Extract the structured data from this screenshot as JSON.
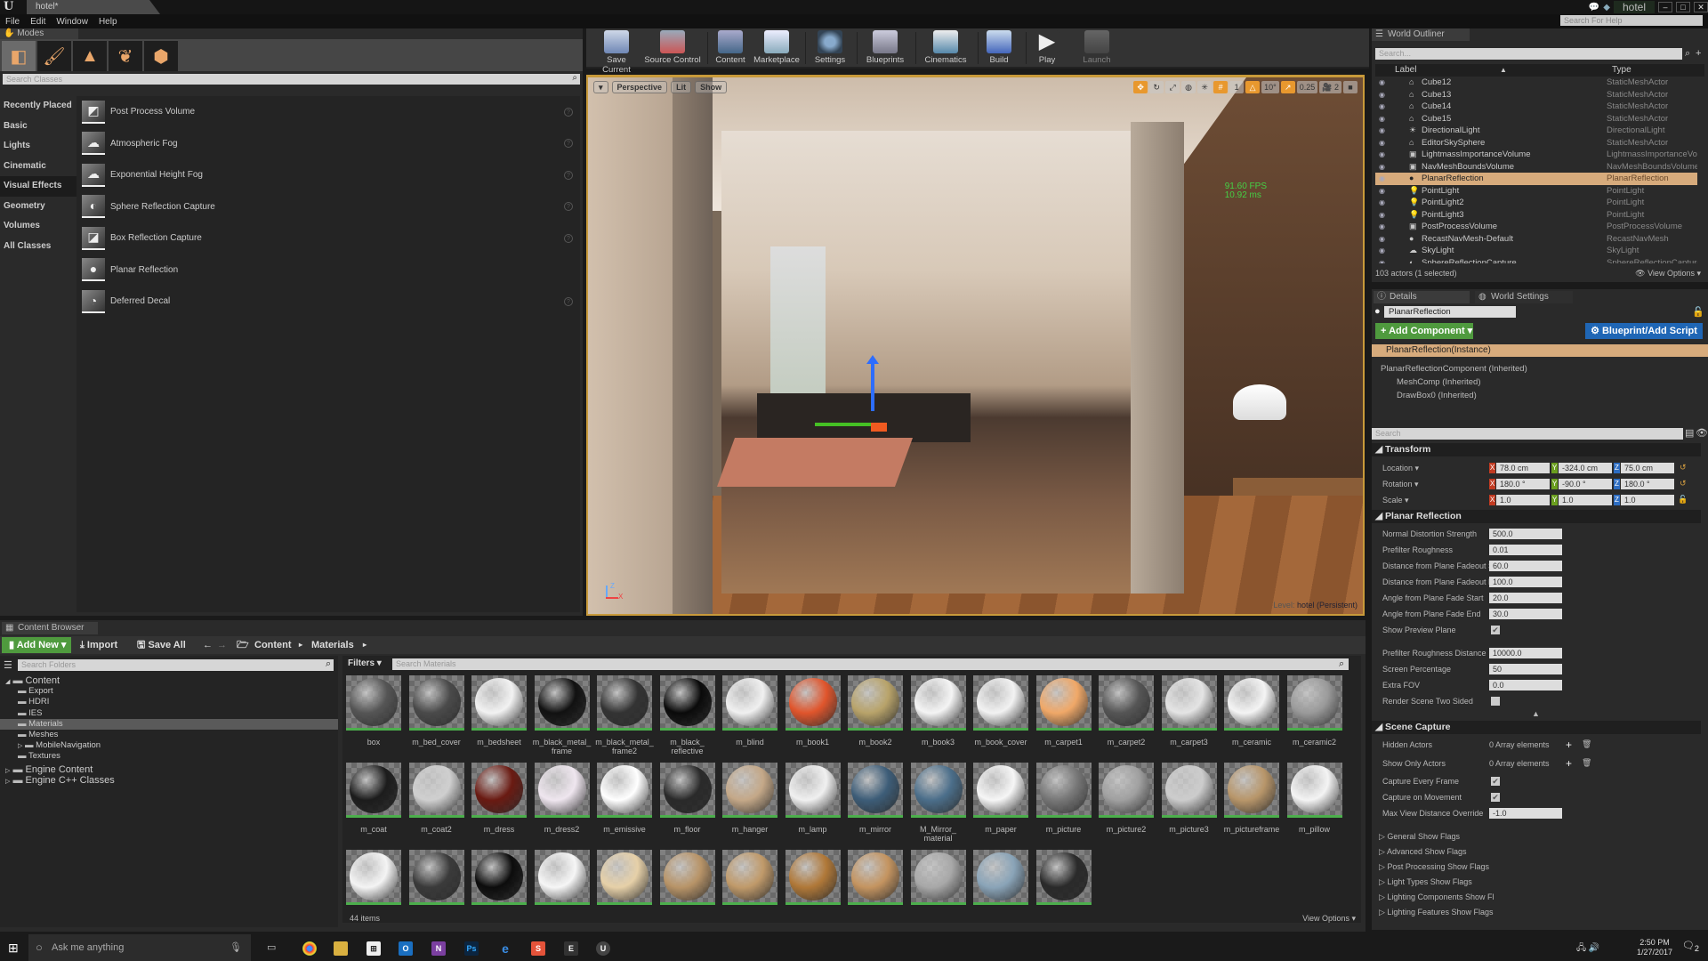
{
  "window": {
    "app_logo": "U",
    "tab_title": "hotel*",
    "project_name": "hotel",
    "minimize": "–",
    "maximize": "□",
    "close": "✕",
    "help_search_placeholder": "Search For Help"
  },
  "menu": [
    "File",
    "Edit",
    "Window",
    "Help"
  ],
  "modes": {
    "tab_label": "Modes",
    "mode_icons": [
      "place-mode-icon",
      "paint-mode-icon",
      "landscape-mode-icon",
      "foliage-mode-icon",
      "geometry-mode-icon"
    ],
    "search_placeholder": "Search Classes",
    "categories": [
      "Recently Placed",
      "Basic",
      "Lights",
      "Cinematic",
      "Visual Effects",
      "Geometry",
      "Volumes",
      "All Classes"
    ],
    "selected_category": "Visual Effects",
    "items": [
      "Post Process Volume",
      "Atmospheric Fog",
      "Exponential Height Fog",
      "Sphere Reflection Capture",
      "Box Reflection Capture",
      "Planar Reflection",
      "Deferred Decal"
    ]
  },
  "toolbar": [
    "Save Current",
    "Source Control",
    "Content",
    "Marketplace",
    "Settings",
    "Blueprints",
    "Cinematics",
    "Build",
    "Play",
    "Launch"
  ],
  "viewport": {
    "view_mode": "Perspective",
    "lighting": "Lit",
    "show": "Show",
    "grid_snap": "1",
    "rotation_snap": "10°",
    "scale_snap": "0.25",
    "camera_speed": "2",
    "fps": "91.60 FPS",
    "frame_ms": "10.92 ms",
    "level_label": "Level:",
    "level_name": "hotel (Persistent)",
    "axis_z": "Z",
    "axis_x": "X"
  },
  "outliner": {
    "tab_label": "World Outliner",
    "search_placeholder": "Search...",
    "col_label": "Label",
    "col_type": "Type",
    "rows": [
      {
        "label": "Cube12",
        "type": "StaticMeshActor",
        "icon": "mesh"
      },
      {
        "label": "Cube13",
        "type": "StaticMeshActor",
        "icon": "mesh"
      },
      {
        "label": "Cube14",
        "type": "StaticMeshActor",
        "icon": "mesh"
      },
      {
        "label": "Cube15",
        "type": "StaticMeshActor",
        "icon": "mesh"
      },
      {
        "label": "DirectionalLight",
        "type": "DirectionalLight",
        "icon": "sun"
      },
      {
        "label": "EditorSkySphere",
        "type": "StaticMeshActor",
        "icon": "mesh"
      },
      {
        "label": "LightmassImportanceVolume",
        "type": "LightmassImportanceVo",
        "icon": "volume"
      },
      {
        "label": "NavMeshBoundsVolume",
        "type": "NavMeshBoundsVolume",
        "icon": "volume"
      },
      {
        "label": "PlanarReflection",
        "type": "PlanarReflection",
        "icon": "sphere",
        "selected": true
      },
      {
        "label": "PointLight",
        "type": "PointLight",
        "icon": "bulb"
      },
      {
        "label": "PointLight2",
        "type": "PointLight",
        "icon": "bulb"
      },
      {
        "label": "PointLight3",
        "type": "PointLight",
        "icon": "bulb"
      },
      {
        "label": "PostProcessVolume",
        "type": "PostProcessVolume",
        "icon": "volume"
      },
      {
        "label": "RecastNavMesh-Default",
        "type": "RecastNavMesh",
        "icon": "sphere"
      },
      {
        "label": "SkyLight",
        "type": "SkyLight",
        "icon": "sky"
      },
      {
        "label": "SphereReflectionCapture",
        "type": "SphereReflectionCapture",
        "icon": "capture"
      }
    ],
    "status": "103 actors (1 selected)",
    "view_options": "View Options"
  },
  "details": {
    "tab_details": "Details",
    "tab_world_settings": "World Settings",
    "actor_name": "PlanarReflection",
    "add_component": "+ Add Component ▾",
    "blueprint_script": "Blueprint/Add Script",
    "instance": "PlanarReflection(Instance)",
    "components": [
      "PlanarReflectionComponent (Inherited)",
      "MeshComp (Inherited)",
      "DrawBox0 (Inherited)"
    ],
    "search_placeholder": "Search",
    "transform": {
      "title": "Transform",
      "location_label": "Location ▾",
      "location": [
        "78.0 cm",
        "-324.0 cm",
        "75.0 cm"
      ],
      "rotation_label": "Rotation ▾",
      "rotation": [
        "180.0 °",
        "-90.0 °",
        "180.0 °"
      ],
      "scale_label": "Scale ▾",
      "scale": [
        "1.0",
        "1.0",
        "1.0"
      ]
    },
    "planar_reflection": {
      "title": "Planar Reflection",
      "props": [
        {
          "label": "Normal Distortion Strength",
          "value": "500.0"
        },
        {
          "label": "Prefilter Roughness",
          "value": "0.01"
        },
        {
          "label": "Distance from Plane Fadeout S",
          "value": "60.0"
        },
        {
          "label": "Distance from Plane Fadeout E",
          "value": "100.0"
        },
        {
          "label": "Angle from Plane Fade Start",
          "value": "20.0"
        },
        {
          "label": "Angle from Plane Fade End",
          "value": "30.0"
        }
      ],
      "show_preview_plane": {
        "label": "Show Preview Plane",
        "checked": true
      },
      "advanced": [
        {
          "label": "Prefilter Roughness Distance",
          "value": "10000.0"
        },
        {
          "label": "Screen Percentage",
          "value": "50"
        },
        {
          "label": "Extra FOV",
          "value": "0.0"
        }
      ],
      "render_two_sided": {
        "label": "Render Scene Two Sided",
        "checked": false
      }
    },
    "scene_capture": {
      "title": "Scene Capture",
      "hidden_actors": {
        "label": "Hidden Actors",
        "value": "0 Array elements"
      },
      "show_only_actors": {
        "label": "Show Only Actors",
        "value": "0 Array elements"
      },
      "capture_every_frame": {
        "label": "Capture Every Frame",
        "checked": true
      },
      "capture_on_movement": {
        "label": "Capture on Movement",
        "checked": true
      },
      "max_view_distance": {
        "label": "Max View Distance Override",
        "value": "-1.0"
      }
    },
    "flags": [
      "General Show Flags",
      "Advanced Show Flags",
      "Post Processing Show Flags",
      "Light Types Show Flags",
      "Lighting Components Show Fl",
      "Lighting Features Show Flags"
    ]
  },
  "content_browser": {
    "tab_label": "Content Browser",
    "add_new": "Add New ▾",
    "import": "Import",
    "save_all": "Save All",
    "breadcrumb": [
      "Content",
      "Materials"
    ],
    "search_folders_placeholder": "Search Folders",
    "folders": [
      {
        "name": "Content",
        "level": 0,
        "expanded": true
      },
      {
        "name": "Export",
        "level": 1
      },
      {
        "name": "HDRI",
        "level": 1
      },
      {
        "name": "IES",
        "level": 1
      },
      {
        "name": "Materials",
        "level": 1,
        "selected": true
      },
      {
        "name": "Meshes",
        "level": 1
      },
      {
        "name": "MobileNavigation",
        "level": 1,
        "collapsed": true
      },
      {
        "name": "Textures",
        "level": 1
      },
      {
        "name": "Engine Content",
        "level": 0,
        "collapsed": true
      },
      {
        "name": "Engine C++ Classes",
        "level": 0,
        "collapsed": true
      }
    ],
    "filters": "Filters ▾",
    "search_assets_placeholder": "Search Materials",
    "assets": [
      {
        "name": "box",
        "color": "#555555"
      },
      {
        "name": "m_bed_cover",
        "color": "#4a4a4a"
      },
      {
        "name": "m_bedsheet",
        "color": "#f2f2f2"
      },
      {
        "name": "m_black_metal_ frame",
        "color": "#111111"
      },
      {
        "name": "m_black_metal_ frame2",
        "color": "#333333"
      },
      {
        "name": "m_black_ reflective",
        "color": "#0a0a0a"
      },
      {
        "name": "m_blind",
        "color": "#f0f0f0"
      },
      {
        "name": "m_book1",
        "color": "#e0552c"
      },
      {
        "name": "m_book2",
        "color": "#b8a36a"
      },
      {
        "name": "m_book3",
        "color": "#f4f4f4"
      },
      {
        "name": "m_book_cover",
        "color": "#f2f2f2"
      },
      {
        "name": "m_carpet1",
        "color": "#f0a868"
      },
      {
        "name": "m_carpet2",
        "color": "#555555"
      },
      {
        "name": "m_carpet3",
        "color": "#e4e4e4"
      },
      {
        "name": "m_ceramic",
        "color": "#f4f4f4"
      },
      {
        "name": "m_ceramic2",
        "color": "#9a9a9a"
      },
      {
        "name": "m_coat",
        "color": "#1c1c1c"
      },
      {
        "name": "m_coat2",
        "color": "#cfcfcf"
      },
      {
        "name": "m_dress",
        "color": "#6a1a12"
      },
      {
        "name": "m_dress2",
        "color": "#efe6ef"
      },
      {
        "name": "m_emissive",
        "color": "#ffffff"
      },
      {
        "name": "m_floor",
        "color": "#2a2a2a"
      },
      {
        "name": "m_hanger",
        "color": "#c4a888"
      },
      {
        "name": "m_lamp",
        "color": "#f0f0f0"
      },
      {
        "name": "m_mirror",
        "color": "#3d5d78"
      },
      {
        "name": "M_Mirror_ material",
        "color": "#4b6e8a"
      },
      {
        "name": "m_paper",
        "color": "#f6f6f6"
      },
      {
        "name": "m_picture",
        "color": "#777777"
      },
      {
        "name": "m_picture2",
        "color": "#a0a0a0"
      },
      {
        "name": "m_picture3",
        "color": "#cccccc"
      },
      {
        "name": "m_pictureframe",
        "color": "#b8966a"
      },
      {
        "name": "m_pillow",
        "color": "#f4f4f4"
      },
      {
        "name": "",
        "color": "#f4f4f4"
      },
      {
        "name": "",
        "color": "#3a3a3a"
      },
      {
        "name": "",
        "color": "#0c0c0c"
      },
      {
        "name": "",
        "color": "#f6f6f6"
      },
      {
        "name": "",
        "color": "#e6d0a8"
      },
      {
        "name": "",
        "color": "#b89468"
      },
      {
        "name": "",
        "color": "#c09a6a"
      },
      {
        "name": "",
        "color": "#b07838"
      },
      {
        "name": "",
        "color": "#c49460"
      },
      {
        "name": "",
        "color": "#a8a8a8"
      },
      {
        "name": "",
        "color": "#8aa4b8"
      },
      {
        "name": "",
        "color": "#2a2a2a"
      }
    ],
    "item_count": "44 items",
    "view_options": "View Options ▾"
  },
  "taskbar": {
    "search_placeholder": "Ask me anything",
    "apps": [
      "chrome",
      "explorer",
      "store",
      "outlook",
      "onenote",
      "photoshop",
      "edge",
      "substance",
      "epic",
      "unreal"
    ],
    "time": "2:50 PM",
    "date": "1/27/2017",
    "notifications": "2"
  }
}
